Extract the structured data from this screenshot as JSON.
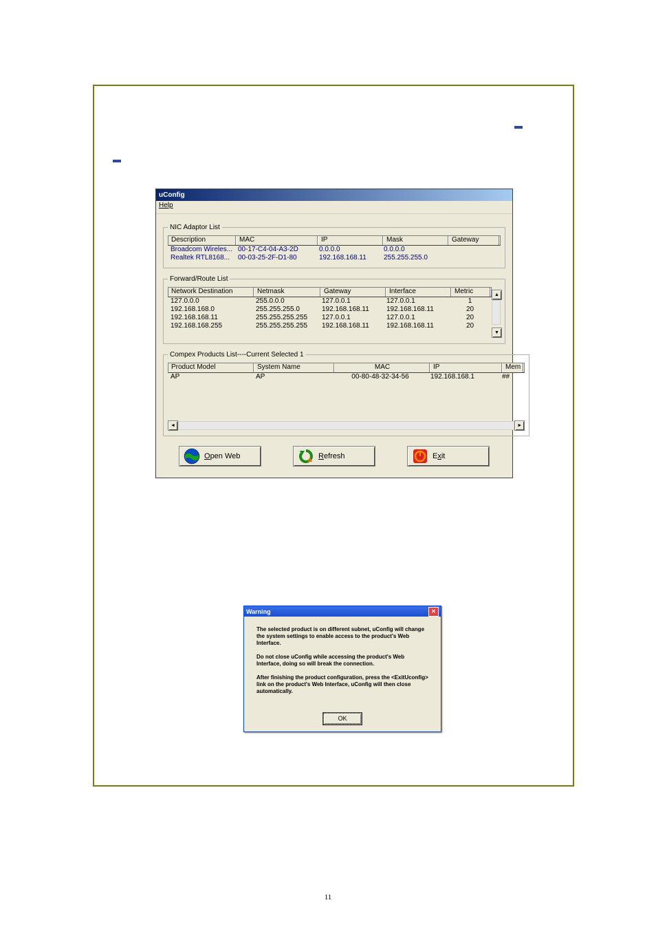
{
  "page_number": "11",
  "app": {
    "title": "uConfig",
    "menu_help": "Help",
    "nic": {
      "legend": "NIC Adaptor List",
      "headers": [
        "Description",
        "MAC",
        "IP",
        "Mask",
        "Gateway"
      ],
      "rows": [
        {
          "desc": "Broadcom Wireles...",
          "mac": "00-17-C4-04-A3-2D",
          "ip": "0.0.0.0",
          "mask": "0.0.0.0",
          "gw": ""
        },
        {
          "desc": "Realtek RTL8168...",
          "mac": "00-03-25-2F-D1-80",
          "ip": "192.168.168.11",
          "mask": "255.255.255.0",
          "gw": ""
        }
      ]
    },
    "routes": {
      "legend": "Forward/Route List",
      "headers": [
        "Network Destination",
        "Netmask",
        "Gateway",
        "Interface",
        "Metric"
      ],
      "rows": [
        {
          "dest": "127.0.0.0",
          "mask": "255.0.0.0",
          "gw": "127.0.0.1",
          "if": "127.0.0.1",
          "metric": "1"
        },
        {
          "dest": "192.168.168.0",
          "mask": "255.255.255.0",
          "gw": "192.168.168.11",
          "if": "192.168.168.11",
          "metric": "20"
        },
        {
          "dest": "192.168.168.11",
          "mask": "255.255.255.255",
          "gw": "127.0.0.1",
          "if": "127.0.0.1",
          "metric": "20"
        },
        {
          "dest": "192.168.168.255",
          "mask": "255.255.255.255",
          "gw": "192.168.168.11",
          "if": "192.168.168.11",
          "metric": "20"
        }
      ]
    },
    "products": {
      "legend": "Compex Products List----Current Selected 1",
      "headers": [
        "Product Model",
        "System Name",
        "MAC",
        "IP",
        "Mem"
      ],
      "rows": [
        {
          "model": "AP",
          "name": "AP",
          "mac": "00-80-48-32-34-56",
          "ip": "192.168.168.1",
          "mem": "##"
        }
      ]
    },
    "buttons": {
      "open_web": "Open Web",
      "refresh": "Refresh",
      "exit": "Exit"
    }
  },
  "dialog": {
    "title": "Warning",
    "p1": "The selected product is on different subnet, uConfig will change the system settings to enable access to the product's Web Interface.",
    "p2": "Do not close uConfig while accessing the product's Web Interface, doing so will break the connection.",
    "p3": "After finishing the product configuration, press the <ExitUconfig> link on the product's Web Interface, uConfig will then close automatically.",
    "ok": "OK"
  }
}
